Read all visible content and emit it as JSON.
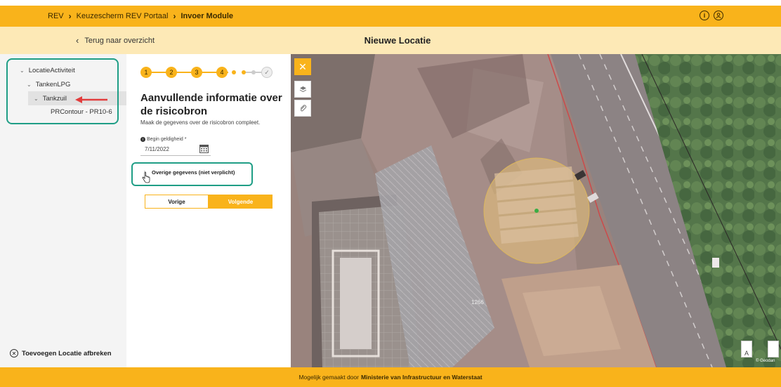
{
  "header": {
    "breadcrumbs": [
      "REV",
      "Keuzescherm REV Portaal",
      "Invoer Module"
    ],
    "icons": [
      "info-icon",
      "user-icon"
    ]
  },
  "subheader": {
    "back_label": "Terug naar overzicht",
    "title": "Nieuwe Locatie"
  },
  "tree": {
    "items": [
      {
        "label": "LocatieActiviteit",
        "level": 0,
        "expanded": true
      },
      {
        "label": "TankenLPG",
        "level": 1,
        "expanded": true
      },
      {
        "label": "Tankzuil",
        "level": 2,
        "expanded": true,
        "selected": true
      },
      {
        "label": "PRContour - PR10-6",
        "level": 3
      }
    ],
    "cancel_label": "Toevoegen Locatie afbreken"
  },
  "stepper": {
    "steps": [
      "1",
      "2",
      "3",
      "4"
    ],
    "done_mark": "✓"
  },
  "form": {
    "title": "Aanvullende informatie over de risicobron",
    "subtitle": "Maak de gegevens over de risicobron compleet.",
    "date_label": "Begin geldigheid *",
    "date_value": "7/11/2022",
    "optional_label": "Overige gegevens (niet verplicht)",
    "prev_label": "Vorige",
    "next_label": "Volgende"
  },
  "map": {
    "label": "1266",
    "attribution": "© Geodan",
    "layer_label": "A",
    "accent": "#f9b31b"
  },
  "footer": {
    "prefix": "Mogelijk gemaakt door",
    "org": "Ministerie van Infrastructuur en Waterstaat"
  },
  "colors": {
    "brand": "#f9b31b",
    "highlight": "#1f9e86",
    "annotation_arrow": "#e23c3c"
  }
}
